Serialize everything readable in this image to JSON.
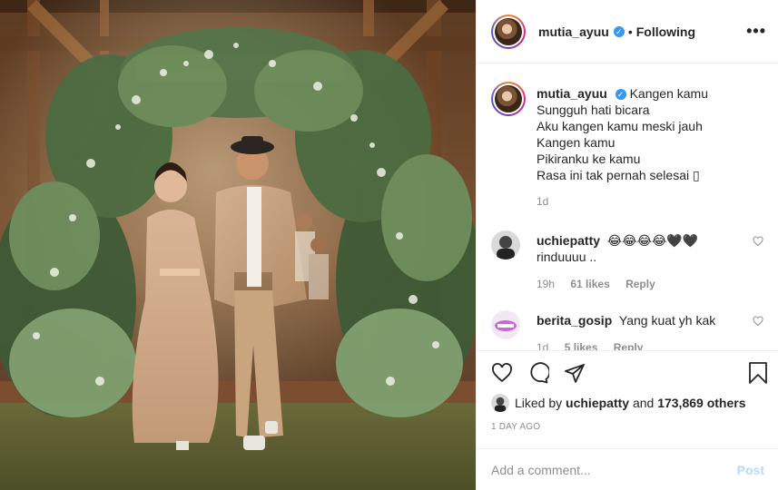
{
  "photo": {
    "alt_icon": "wedding-photo"
  },
  "header": {
    "username": "mutia_ayuu",
    "verified_icon": "verified-badge-icon",
    "separator": "•",
    "following": "Following",
    "more": "•••"
  },
  "caption": {
    "username": "mutia_ayuu",
    "first_line": "Kangen kamu",
    "lines": [
      "Sungguh hati bicara",
      "Aku kangen kamu meski jauh",
      "Kangen kamu",
      "Pikiranku ke kamu",
      "Rasa ini tak pernah selesai ▯"
    ],
    "time": "1d"
  },
  "comments": [
    {
      "username": "uchiepatty",
      "text_line1": "😂😂😂😂🖤🖤",
      "text_line2": "rinduuuu ..",
      "time": "19h",
      "likes": "61 likes",
      "reply": "Reply"
    },
    {
      "username": "berita_gosip",
      "text_line1": "Yang kuat yh kak",
      "time": "1d",
      "likes": "5 likes",
      "reply": "Reply"
    }
  ],
  "likes": {
    "prefix": "Liked by",
    "user": "uchiepatty",
    "and": "and",
    "others": "173,869 others"
  },
  "date": "1 DAY AGO",
  "add_comment": {
    "placeholder": "Add a comment...",
    "post_label": "Post"
  }
}
